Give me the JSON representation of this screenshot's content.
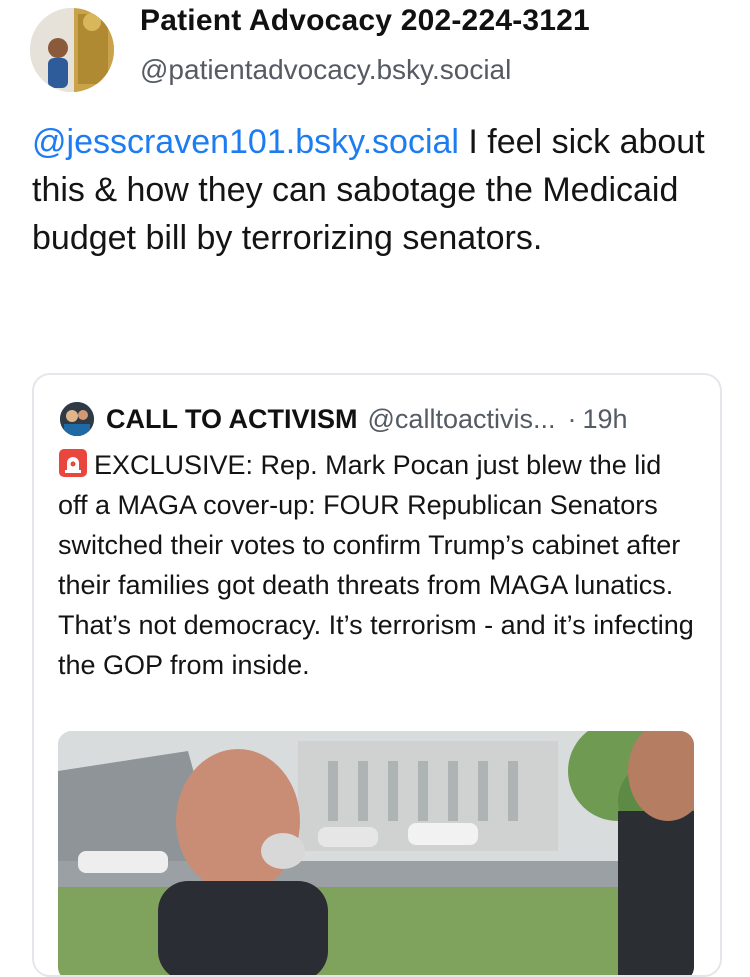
{
  "post": {
    "author_name": "Patient Advocacy 202-224-3121",
    "author_handle": "@patientadvocacy.bsky.social",
    "mention": "@jesscraven101.bsky.social",
    "text": " I feel sick about this & how they can sabotage the Medicaid budget bill by terrorizing senators."
  },
  "quote": {
    "author_name": "CALL TO ACTIVISM",
    "author_handle": "@calltoactivis...",
    "separator": "·",
    "time": "19h",
    "text": "EXCLUSIVE: Rep. Mark Pocan just blew the lid off a MAGA cover-up: FOUR Republican Senators switched their votes to confirm Trump’s cabinet after their families got death threats from MAGA lunatics. That’s not democracy. It’s terrorism - and it’s infecting the GOP from inside.",
    "emoji_icon": "rotating-light-icon"
  },
  "icons": {
    "avatar": "profile-avatar",
    "quote_avatar": "call-to-activism-avatar"
  },
  "colors": {
    "mention": "#1d7cf2",
    "handle": "#555b63",
    "card_border": "#e3e6ea"
  }
}
